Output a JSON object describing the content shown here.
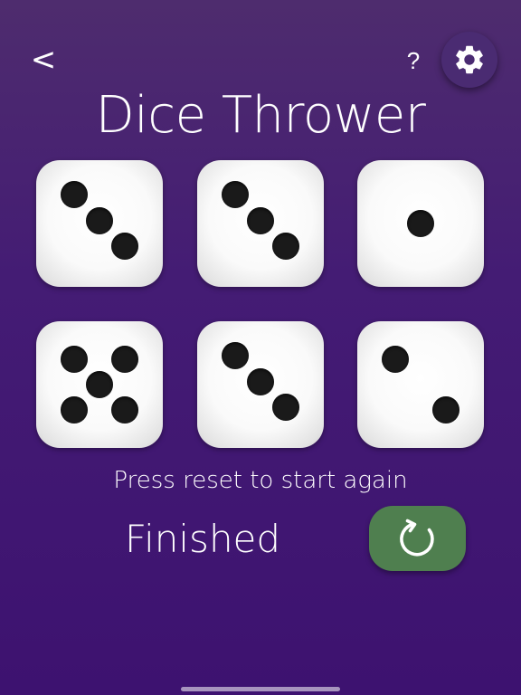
{
  "header": {
    "back_label": "<",
    "help_label": "?",
    "settings_icon": "gear-icon"
  },
  "title": "Dice Thrower",
  "dice": [
    {
      "value": 3
    },
    {
      "value": 3
    },
    {
      "value": 1
    },
    {
      "value": 5
    },
    {
      "value": 3
    },
    {
      "value": 2
    }
  ],
  "status": {
    "message": "Press reset to start again",
    "state": "Finished"
  },
  "reset_button": {
    "icon": "refresh-icon"
  },
  "colors": {
    "background": "#441c74",
    "reset_button": "#4f7f4f",
    "pip": "#1a1a1a",
    "die_face": "#ffffff"
  }
}
